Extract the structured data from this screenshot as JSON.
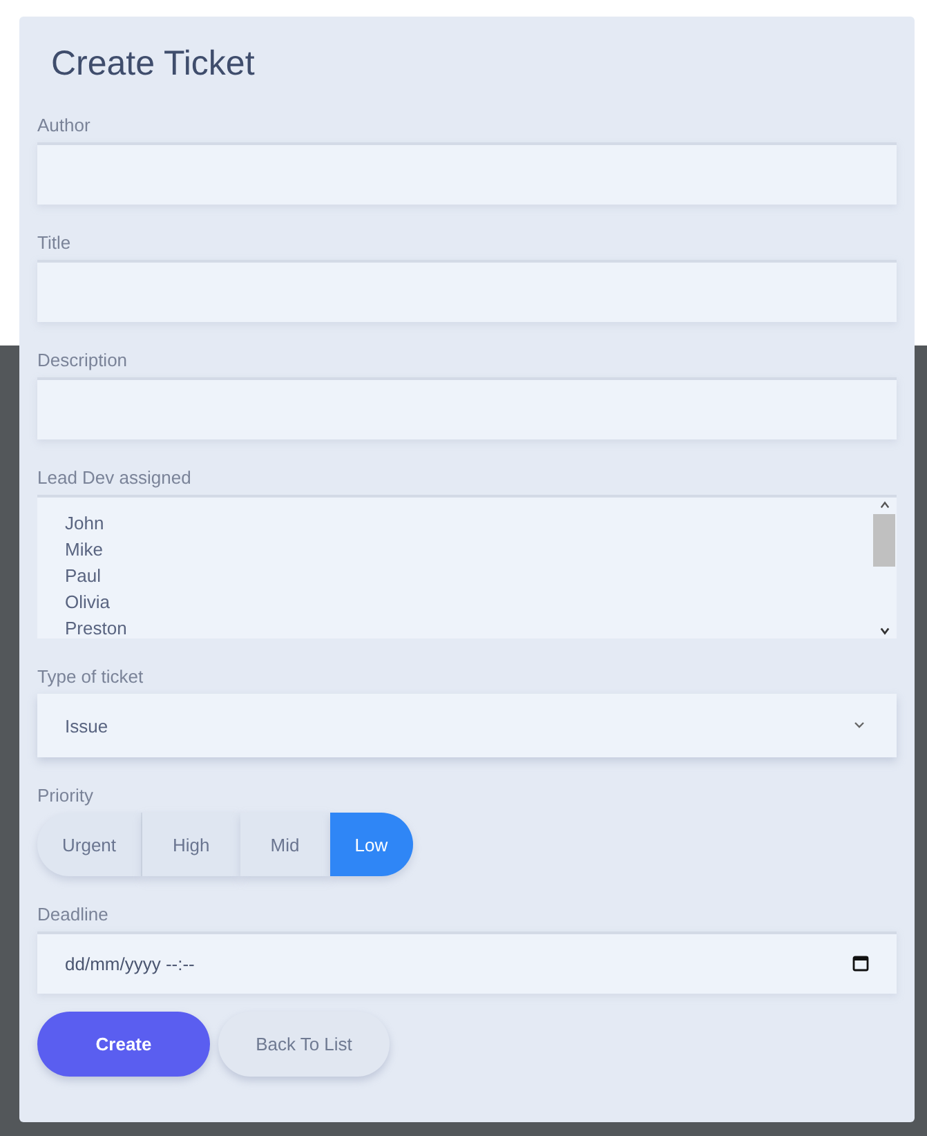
{
  "form": {
    "title": "Create Ticket",
    "text_fields": [
      {
        "label": "Author"
      },
      {
        "label": "Title"
      },
      {
        "label": "Description"
      }
    ],
    "lead_dev": {
      "label": "Lead Dev assigned",
      "options": [
        "John",
        "Mike",
        "Paul",
        "Olivia",
        "Preston"
      ]
    },
    "ticket_type": {
      "label": "Type of ticket",
      "value": "Issue"
    },
    "priority": {
      "label": "Priority",
      "options": [
        {
          "label": "Urgent",
          "selected": false
        },
        {
          "label": "High",
          "selected": false
        },
        {
          "label": "Mid",
          "selected": false
        },
        {
          "label": "Low",
          "selected": true
        }
      ]
    },
    "deadline": {
      "label": "Deadline",
      "placeholder": "dd/mm/yyyy --:--"
    },
    "buttons": [
      {
        "label": "Create",
        "kind": "primary"
      },
      {
        "label": "Back To List",
        "kind": "secondary"
      }
    ]
  }
}
